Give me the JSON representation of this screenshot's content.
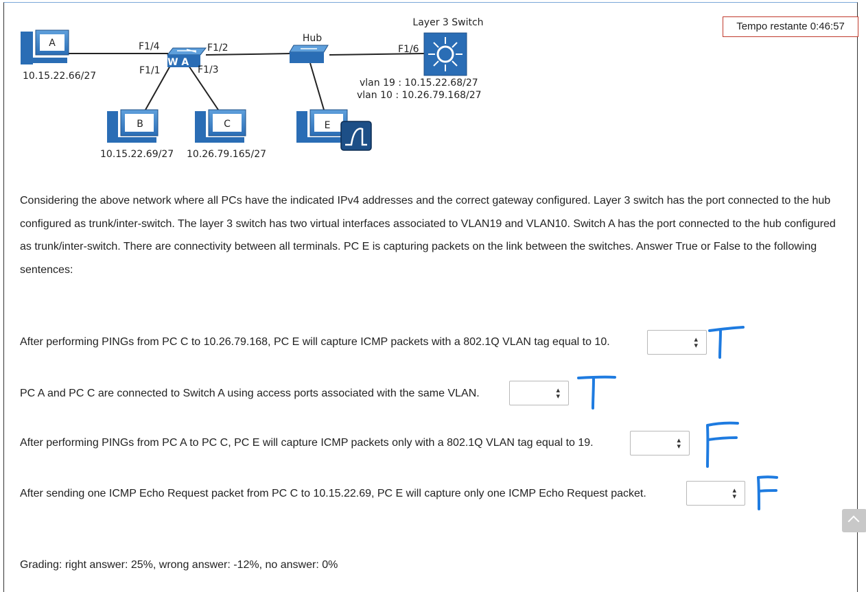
{
  "timer": {
    "text": "Tempo restante 0:46:57"
  },
  "diagram": {
    "pc_a": {
      "label": "A",
      "ip": "10.15.22.66/27"
    },
    "pc_b": {
      "label": "B",
      "ip": "10.15.22.69/27"
    },
    "pc_c": {
      "label": "C",
      "ip": "10.26.79.165/27"
    },
    "pc_e": {
      "label": "E"
    },
    "switch_a": {
      "label": "SW A",
      "ports": [
        "F1/4",
        "F1/2",
        "F1/1",
        "F1/3"
      ]
    },
    "hub": {
      "label": "Hub"
    },
    "l3_switch": {
      "label": "Layer 3 Switch",
      "port": "F1/6",
      "vlans": [
        "vlan 19 : 10.15.22.68/27",
        "vlan 10 : 10.26.79.168/27"
      ]
    }
  },
  "intro": "Considering the above network where all PCs have the indicated IPv4 addresses and the correct gateway configured. Layer 3 switch has the port connected to the hub configured as trunk/inter-switch. The layer 3 switch has two virtual interfaces associated to VLAN19 and VLAN10. Switch A has the port connected to the hub configured as trunk/inter-switch. There are connectivity between all terminals. PC E is capturing packets on the link between the switches. Answer True or False to the following sentences:",
  "questions": [
    {
      "text": "After performing PINGs from PC C to 10.26.79.168, PC E will capture ICMP packets with a 802.1Q VLAN tag equal to 10.",
      "selected": "",
      "handwritten": "T"
    },
    {
      "text": "PC A and PC C are connected to Switch A using access ports associated with the same VLAN.",
      "selected": "",
      "handwritten": "T"
    },
    {
      "text": "After performing PINGs from PC A to PC C, PC E will capture ICMP packets only with a 802.1Q VLAN tag equal to 19.",
      "selected": "",
      "handwritten": "F"
    },
    {
      "text": "After sending one ICMP Echo Request packet from PC C to 10.15.22.69, PC E will capture only one ICMP Echo Request packet.",
      "selected": "",
      "handwritten": "F"
    }
  ],
  "grading": "Grading: right answer: 25%, wrong answer: -12%, no answer: 0%",
  "colors": {
    "accent": "#1e7be0",
    "device": "#2a6db5",
    "timer_border": "#c0392b"
  }
}
